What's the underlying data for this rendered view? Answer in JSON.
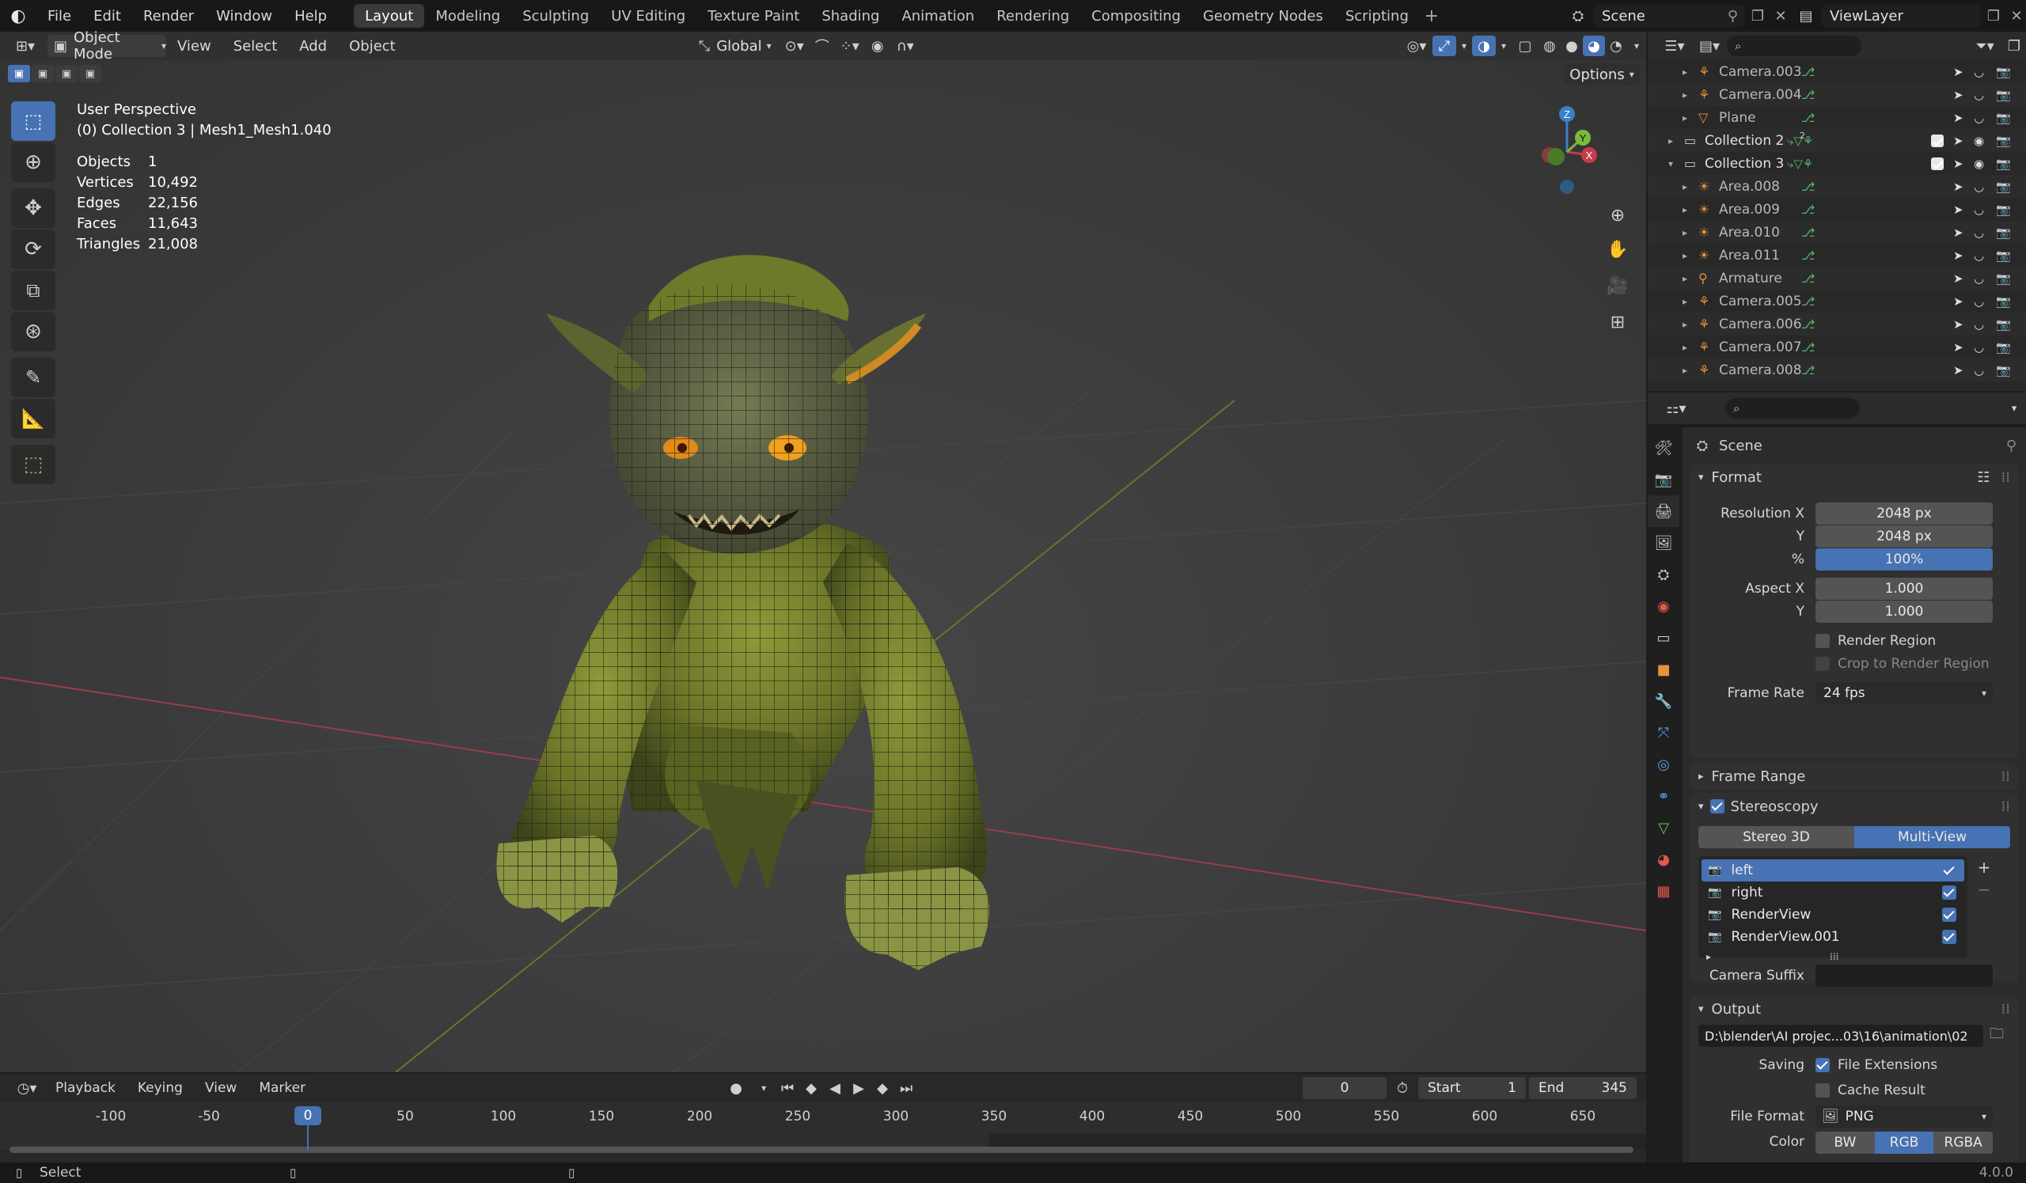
{
  "topbar": {
    "menus": [
      "File",
      "Edit",
      "Render",
      "Window",
      "Help"
    ],
    "workspaces": [
      "Layout",
      "Modeling",
      "Sculpting",
      "UV Editing",
      "Texture Paint",
      "Shading",
      "Animation",
      "Rendering",
      "Compositing",
      "Geometry Nodes",
      "Scripting"
    ],
    "active_workspace": "Layout",
    "scene": "Scene",
    "view_layer": "ViewLayer"
  },
  "viewport_header": {
    "mode": "Object Mode",
    "menus": [
      "View",
      "Select",
      "Add",
      "Object"
    ],
    "orientation": "Global",
    "options": "Options"
  },
  "viewport": {
    "perspective": "User Perspective",
    "collection_line": "(0) Collection 3 | Mesh1_Mesh1.040",
    "stats": [
      {
        "label": "Objects",
        "value": "1"
      },
      {
        "label": "Vertices",
        "value": "10,492"
      },
      {
        "label": "Edges",
        "value": "22,156"
      },
      {
        "label": "Faces",
        "value": "11,643"
      },
      {
        "label": "Triangles",
        "value": "21,008"
      }
    ],
    "gizmo": {
      "z": "Z",
      "y": "Y",
      "x": "X"
    }
  },
  "outliner": {
    "rows": [
      {
        "name": "Camera.003",
        "type": "camera",
        "indent": 2
      },
      {
        "name": "Camera.004",
        "type": "camera",
        "indent": 2
      },
      {
        "name": "Plane",
        "type": "mesh",
        "indent": 2
      },
      {
        "name": "Collection 2",
        "type": "collection",
        "indent": 1,
        "badge": "2"
      },
      {
        "name": "Collection 3",
        "type": "collection",
        "indent": 1,
        "expanded": true
      },
      {
        "name": "Area.008",
        "type": "light",
        "indent": 2
      },
      {
        "name": "Area.009",
        "type": "light",
        "indent": 2
      },
      {
        "name": "Area.010",
        "type": "light",
        "indent": 2
      },
      {
        "name": "Area.011",
        "type": "light",
        "indent": 2
      },
      {
        "name": "Armature",
        "type": "armature",
        "indent": 2
      },
      {
        "name": "Camera.005",
        "type": "camera",
        "indent": 2
      },
      {
        "name": "Camera.006",
        "type": "camera",
        "indent": 2
      },
      {
        "name": "Camera.007",
        "type": "camera",
        "indent": 2
      },
      {
        "name": "Camera.008",
        "type": "camera",
        "indent": 2
      }
    ]
  },
  "properties": {
    "context": "Scene",
    "format": {
      "header": "Format",
      "res_x_label": "Resolution X",
      "res_x": "2048 px",
      "res_y_label": "Y",
      "res_y": "2048 px",
      "pct_label": "%",
      "pct": "100%",
      "aspect_x_label": "Aspect X",
      "aspect_x": "1.000",
      "aspect_y_label": "Y",
      "aspect_y": "1.000",
      "render_region": "Render Region",
      "crop": "Crop to Render Region",
      "frame_rate_label": "Frame Rate",
      "frame_rate": "24 fps"
    },
    "frame_range": "Frame Range",
    "stereoscopy": {
      "header": "Stereoscopy",
      "mode_a": "Stereo 3D",
      "mode_b": "Multi-View",
      "views": [
        "left",
        "right",
        "RenderView",
        "RenderView.001"
      ],
      "camera_suffix_label": "Camera Suffix"
    },
    "output": {
      "header": "Output",
      "path": "D:\\blender\\AI projec...03\\16\\animation\\02",
      "saving_label": "Saving",
      "file_ext": "File Extensions",
      "cache": "Cache Result",
      "file_format_label": "File Format",
      "file_format": "PNG",
      "color_label": "Color",
      "color_opts": [
        "BW",
        "RGB",
        "RGBA"
      ]
    }
  },
  "timeline": {
    "menus": [
      "Playback",
      "Keying",
      "View",
      "Marker"
    ],
    "current_frame": "0",
    "start_label": "Start",
    "start": "1",
    "end_label": "End",
    "end": "345",
    "ticks": [
      "-100",
      "-50",
      "0",
      "50",
      "100",
      "150",
      "200",
      "250",
      "300",
      "350",
      "400",
      "450",
      "500",
      "550",
      "600",
      "650"
    ]
  },
  "status": {
    "left": "Select",
    "version": "4.0.0"
  }
}
